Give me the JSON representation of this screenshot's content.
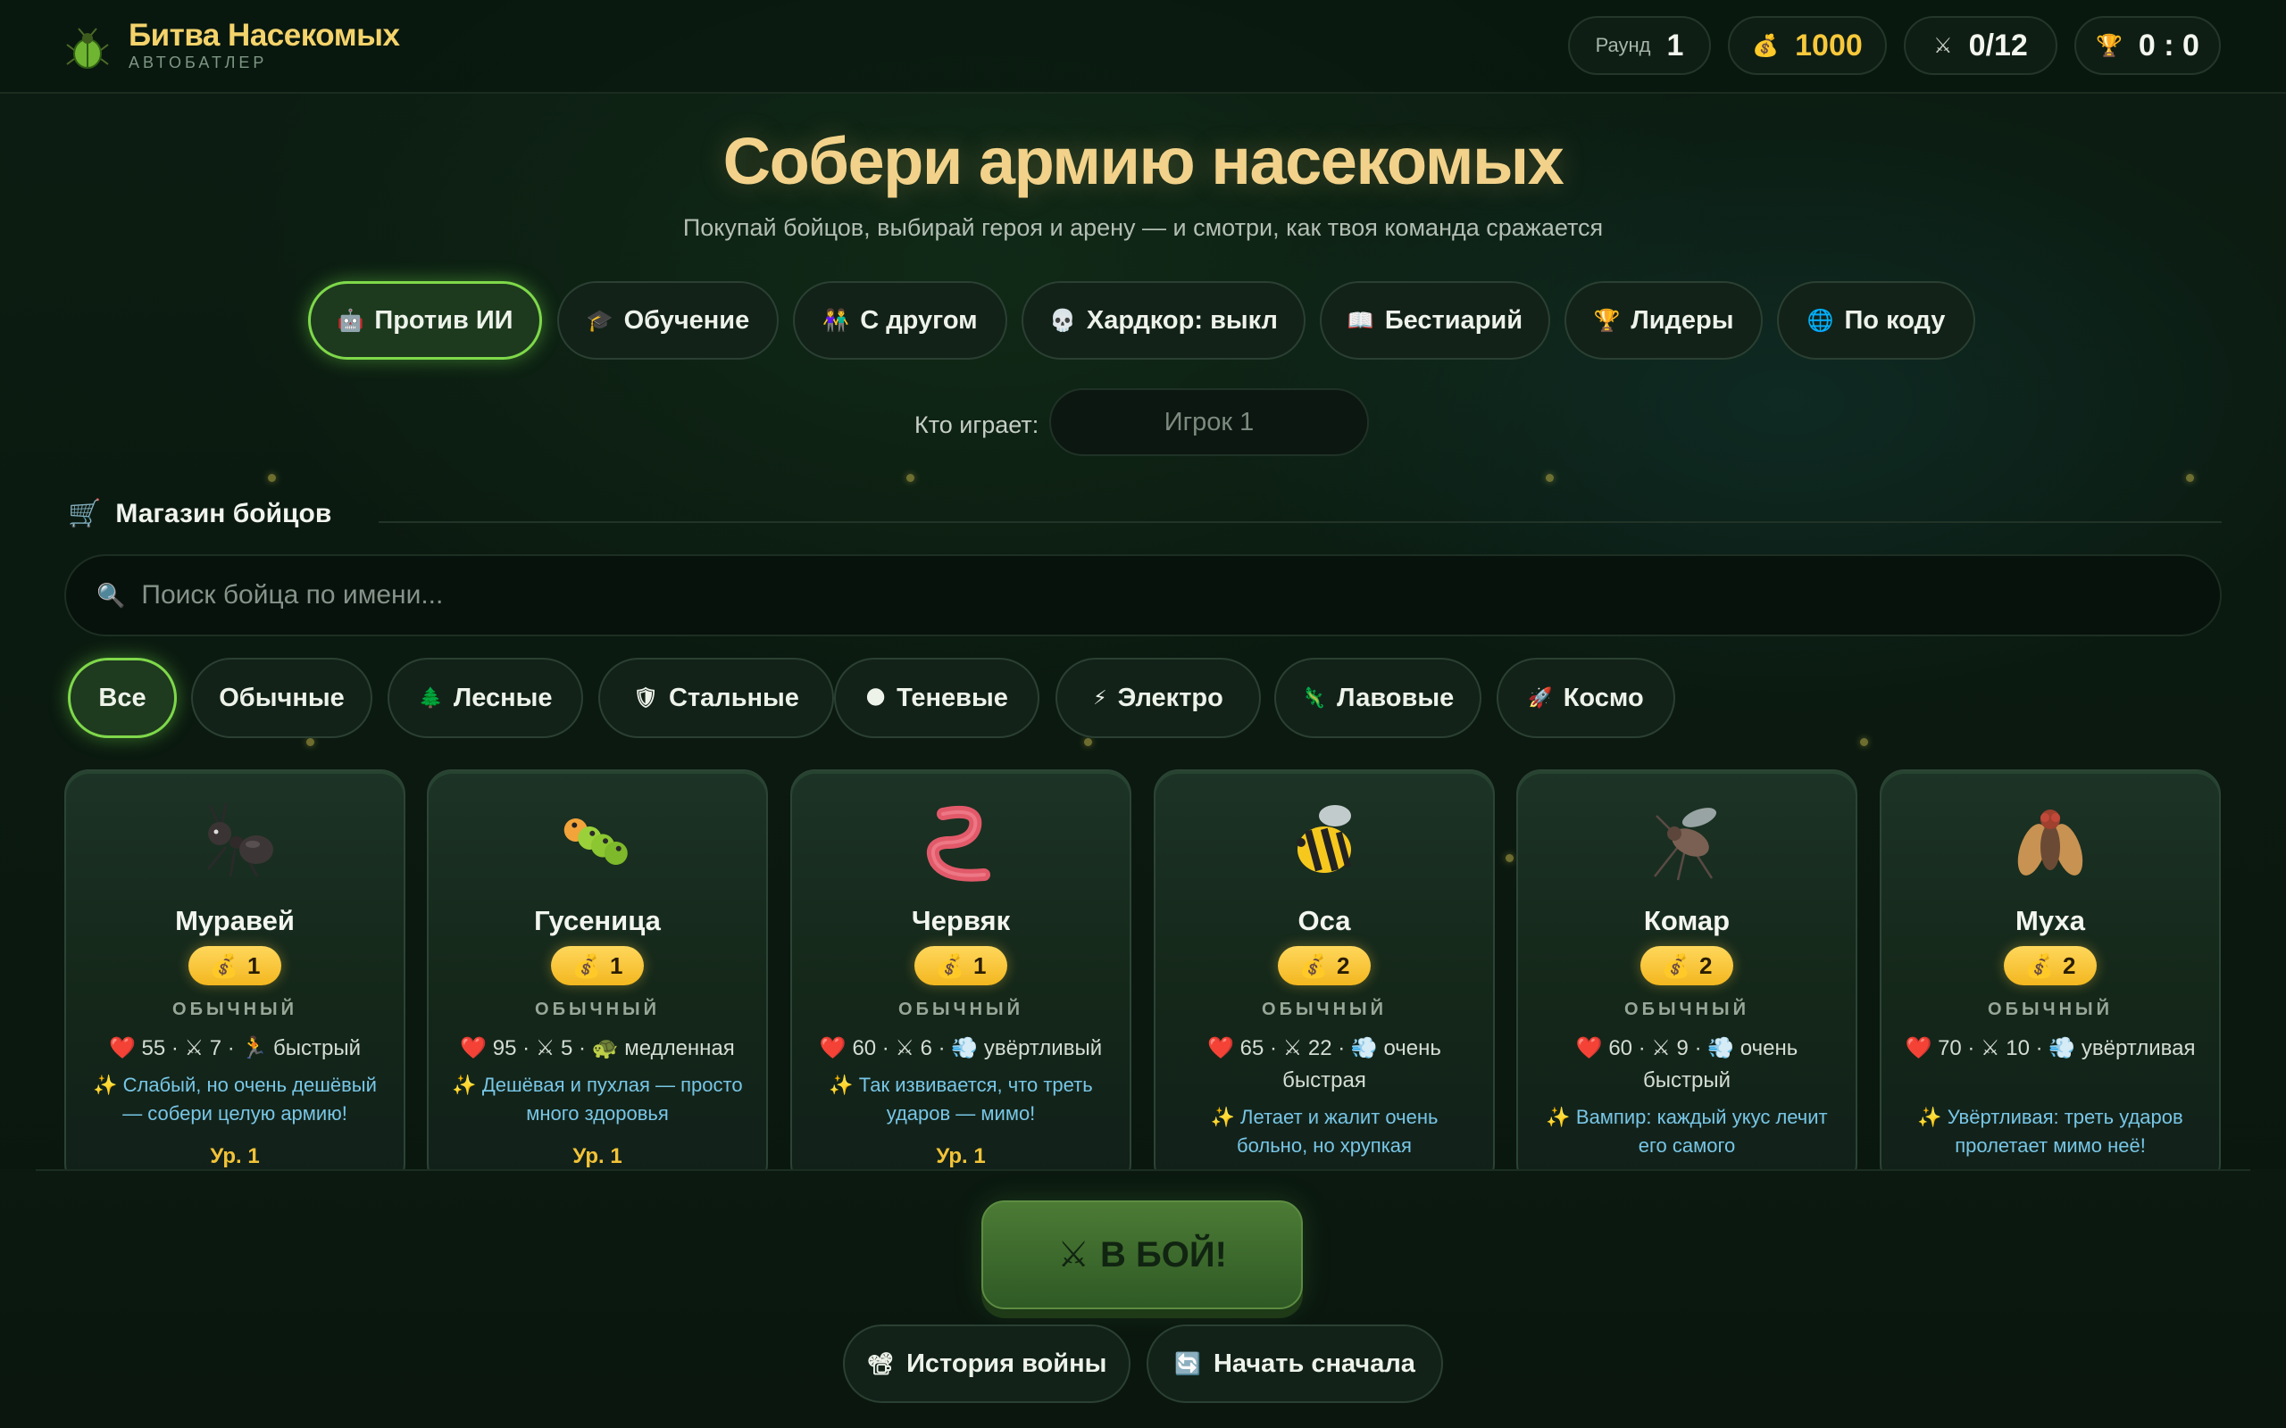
{
  "header": {
    "title": "Битва Насекомых",
    "subtitle": "АВТОБАТЛЕР",
    "round_label": "Раунд",
    "round_value": "1",
    "gold_value": "1000",
    "army_value": "0/12",
    "score_value": "0 : 0"
  },
  "hero": {
    "title": "Собери армию насекомых",
    "subtitle": "Покупай бойцов, выбирай героя и арену — и смотри, как твоя команда сражается"
  },
  "modes": [
    {
      "icon": "🤖",
      "label": "Против ИИ"
    },
    {
      "icon": "🎓",
      "label": "Обучение"
    },
    {
      "icon": "👫",
      "label": "С другом"
    },
    {
      "icon": "💀",
      "label": "Хардкор: выкл"
    },
    {
      "icon": "📖",
      "label": "Бестиарий"
    },
    {
      "icon": "🏆",
      "label": "Лидеры"
    },
    {
      "icon": "🌐",
      "label": "По коду"
    }
  ],
  "player": {
    "label": "Кто играет:",
    "placeholder": "Игрок 1"
  },
  "shop": {
    "icon": "🛒",
    "title": "Магазин бойцов",
    "search_placeholder": "Поиск бойца по имени..."
  },
  "categories": [
    {
      "icon": "",
      "label": "Все"
    },
    {
      "icon": "",
      "label": "Обычные"
    },
    {
      "icon": "🌲",
      "label": "Лесные"
    },
    {
      "icon": "🛡",
      "label": "Стальные"
    },
    {
      "icon": "🌑",
      "label": "Теневые"
    },
    {
      "icon": "⚡",
      "label": "Электро"
    },
    {
      "icon": "🦎",
      "label": "Лавовые"
    },
    {
      "icon": "🚀",
      "label": "Космо"
    }
  ],
  "cards": [
    {
      "name": "Муравей",
      "price": "1",
      "rarity": "ОБЫЧНЫЙ",
      "hp": "55",
      "atk": "7",
      "trait_icon": "🏃",
      "trait": "быстрый",
      "desc": "✨ Слабый, но очень дешёвый — собери целую армию!",
      "level": "Ур. 1"
    },
    {
      "name": "Гусеница",
      "price": "1",
      "rarity": "ОБЫЧНЫЙ",
      "hp": "95",
      "atk": "5",
      "trait_icon": "🐢",
      "trait": "медленная",
      "desc": "✨ Дешёвая и пухлая — просто много здоровья",
      "level": "Ур. 1"
    },
    {
      "name": "Червяк",
      "price": "1",
      "rarity": "ОБЫЧНЫЙ",
      "hp": "60",
      "atk": "6",
      "trait_icon": "💨",
      "trait": "увёртливый",
      "desc": "✨ Так извивается, что треть ударов — мимо!",
      "level": "Ур. 1"
    },
    {
      "name": "Оса",
      "price": "2",
      "rarity": "ОБЫЧНЫЙ",
      "hp": "65",
      "atk": "22",
      "trait_icon": "💨",
      "trait": "очень быстрая",
      "desc": "✨ Летает и жалит очень больно, но хрупкая",
      "level": ""
    },
    {
      "name": "Комар",
      "price": "2",
      "rarity": "ОБЫЧНЫЙ",
      "hp": "60",
      "atk": "9",
      "trait_icon": "💨",
      "trait": "очень быстрый",
      "desc": "✨ Вампир: каждый укус лечит его самого",
      "level": ""
    },
    {
      "name": "Муха",
      "price": "2",
      "rarity": "ОБЫЧНЫЙ",
      "hp": "70",
      "atk": "10",
      "trait_icon": "💨",
      "trait": "увёртливая",
      "desc": "✨ Увёртливая: треть ударов пролетает мимо неё!",
      "level": ""
    }
  ],
  "actions": {
    "fight_label": "В БОЙ!",
    "history_icon": "📽",
    "history_label": "История войны",
    "restart_icon": "🔄",
    "restart_label": "Начать сначала"
  },
  "colors": {
    "accent_green": "#7fd84a",
    "gold": "#f7c83c",
    "title_gold": "#f2d28a",
    "desc_blue": "#78c6e6"
  }
}
